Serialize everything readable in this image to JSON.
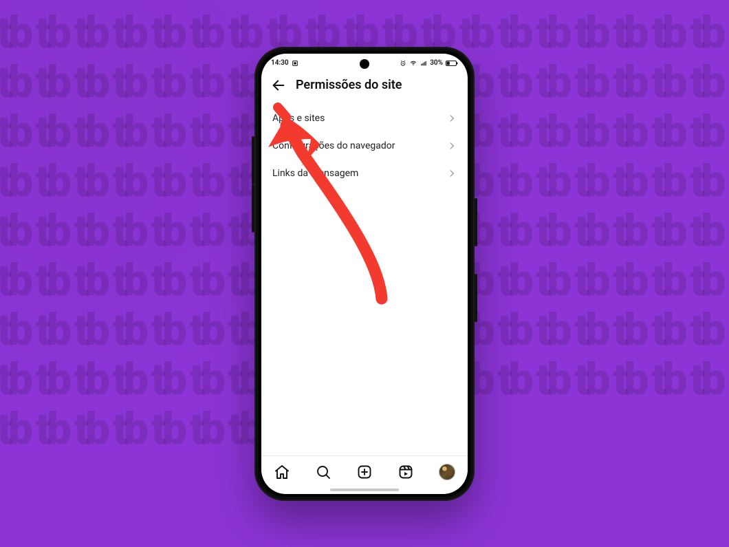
{
  "statusbar": {
    "time": "14:30",
    "battery_text": "30%"
  },
  "header": {
    "title": "Permissões do site"
  },
  "menu": {
    "items": [
      {
        "label": "Apps e sites"
      },
      {
        "label": "Configurações do navegador"
      },
      {
        "label": "Links da mensagem"
      }
    ]
  },
  "annotation": {
    "color": "#f23a2f"
  }
}
